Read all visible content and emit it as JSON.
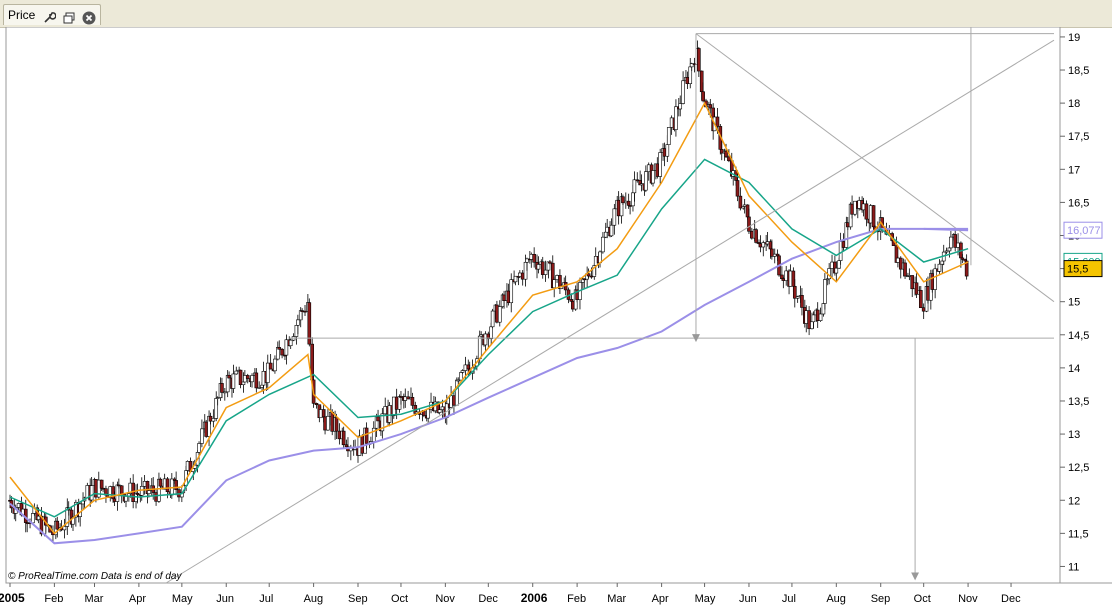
{
  "window": {
    "tab_title": "Price"
  },
  "icons": [
    "wrench-icon",
    "restore-window-icon",
    "close-icon"
  ],
  "colors": {
    "price_up": "#ffffff",
    "price_down": "#8b1a1a",
    "ma_short": "#f39c12",
    "ma_mid": "#17a589",
    "ma_long": "#9b8fe8",
    "trendlines": "#aaaaaa",
    "last_price_bg": "#f5c400"
  },
  "watermark": "© ProRealTime.com  Data is end of day",
  "chart_data": {
    "type": "line",
    "title": "Price",
    "ylim": [
      10.75,
      19.15
    ],
    "y_ticks": [
      "11",
      "11,5",
      "12",
      "12,5",
      "13",
      "13,5",
      "14",
      "14,5",
      "15",
      "15,5",
      "16",
      "16,5",
      "17",
      "17,5",
      "18",
      "18,5",
      "19"
    ],
    "x_labels": [
      "2005",
      "Feb",
      "Mar",
      "Apr",
      "May",
      "Jun",
      "Jul",
      "Aug",
      "Sep",
      "Oct",
      "Nov",
      "Dec",
      "2006",
      "Feb",
      "Mar",
      "Apr",
      "May",
      "Jun",
      "Jul",
      "Aug",
      "Sep",
      "Oct",
      "Nov",
      "Dec"
    ],
    "x_label_dates": [
      "2005-01",
      "2005-02",
      "2005-03",
      "2005-04",
      "2005-05",
      "2005-06",
      "2005-07",
      "2005-08",
      "2005-09",
      "2005-10",
      "2005-11",
      "2005-12",
      "2006-01",
      "2006-02",
      "2006-03",
      "2006-04",
      "2006-05",
      "2006-06",
      "2006-07",
      "2006-08",
      "2006-09",
      "2006-10",
      "2006-11",
      "2006-12"
    ],
    "series": [
      {
        "key": "price",
        "values": [
          [
            "2005-01",
            12.0
          ],
          [
            "2005-02",
            11.5
          ],
          [
            "2005-03",
            12.2
          ],
          [
            "2005-04",
            12.1
          ],
          [
            "2005-05",
            12.2
          ],
          [
            "2005-06",
            13.8
          ],
          [
            "2005-07",
            13.9
          ],
          [
            "2005-07-28",
            15.0
          ],
          [
            "2005-08",
            13.4
          ],
          [
            "2005-09",
            12.8
          ],
          [
            "2005-10",
            13.5
          ],
          [
            "2005-11",
            13.3
          ],
          [
            "2005-12",
            14.6
          ],
          [
            "2006-01",
            15.7
          ],
          [
            "2006-02",
            15.0
          ],
          [
            "2006-03",
            16.4
          ],
          [
            "2006-04",
            17.1
          ],
          [
            "2006-04-25",
            18.8
          ],
          [
            "2006-05",
            18.1
          ],
          [
            "2006-06",
            16.2
          ],
          [
            "2006-07",
            15.3
          ],
          [
            "2006-07-15",
            14.6
          ],
          [
            "2006-08",
            15.6
          ],
          [
            "2006-08-15",
            16.6
          ],
          [
            "2006-09",
            16.1
          ],
          [
            "2006-10",
            15.0
          ],
          [
            "2006-10-20",
            16.0
          ],
          [
            "2006-11",
            15.5
          ]
        ]
      },
      {
        "key": "ma_short",
        "values": [
          [
            "2005-01",
            12.35
          ],
          [
            "2005-02",
            11.5
          ],
          [
            "2005-03",
            12.0
          ],
          [
            "2005-04",
            12.15
          ],
          [
            "2005-05",
            12.2
          ],
          [
            "2005-06",
            13.4
          ],
          [
            "2005-07",
            13.7
          ],
          [
            "2005-07-28",
            14.2
          ],
          [
            "2005-08",
            13.6
          ],
          [
            "2005-09",
            12.95
          ],
          [
            "2005-10",
            13.2
          ],
          [
            "2005-11",
            13.5
          ],
          [
            "2005-12",
            14.3
          ],
          [
            "2006-01",
            15.1
          ],
          [
            "2006-02",
            15.3
          ],
          [
            "2006-03",
            15.8
          ],
          [
            "2006-04",
            16.8
          ],
          [
            "2006-05",
            18.0
          ],
          [
            "2006-06",
            16.6
          ],
          [
            "2006-07",
            15.9
          ],
          [
            "2006-08",
            15.3
          ],
          [
            "2006-09",
            16.2
          ],
          [
            "2006-10",
            15.3
          ],
          [
            "2006-11",
            15.6
          ]
        ]
      },
      {
        "key": "ma_mid",
        "values": [
          [
            "2005-01",
            12.05
          ],
          [
            "2005-02",
            11.75
          ],
          [
            "2005-03",
            12.1
          ],
          [
            "2005-04",
            12.05
          ],
          [
            "2005-05",
            12.1
          ],
          [
            "2005-06",
            13.2
          ],
          [
            "2005-07",
            13.6
          ],
          [
            "2005-08",
            13.9
          ],
          [
            "2005-09",
            13.25
          ],
          [
            "2005-10",
            13.3
          ],
          [
            "2005-11",
            13.5
          ],
          [
            "2005-12",
            14.2
          ],
          [
            "2006-01",
            14.85
          ],
          [
            "2006-02",
            15.15
          ],
          [
            "2006-03",
            15.4
          ],
          [
            "2006-04",
            16.4
          ],
          [
            "2006-05",
            17.15
          ],
          [
            "2006-06",
            16.8
          ],
          [
            "2006-07",
            16.1
          ],
          [
            "2006-08",
            15.7
          ],
          [
            "2006-09",
            16.1
          ],
          [
            "2006-10",
            15.6
          ],
          [
            "2006-11",
            15.8
          ]
        ]
      },
      {
        "key": "ma_long",
        "values": [
          [
            "2005-01",
            11.95
          ],
          [
            "2005-02",
            11.35
          ],
          [
            "2005-03",
            11.4
          ],
          [
            "2005-04",
            11.5
          ],
          [
            "2005-05",
            11.6
          ],
          [
            "2005-06",
            12.3
          ],
          [
            "2005-07",
            12.6
          ],
          [
            "2005-08",
            12.75
          ],
          [
            "2005-09",
            12.8
          ],
          [
            "2005-10",
            13.0
          ],
          [
            "2005-11",
            13.25
          ],
          [
            "2005-12",
            13.55
          ],
          [
            "2006-01",
            13.85
          ],
          [
            "2006-02",
            14.15
          ],
          [
            "2006-03",
            14.3
          ],
          [
            "2006-04",
            14.55
          ],
          [
            "2006-05",
            14.95
          ],
          [
            "2006-06",
            15.3
          ],
          [
            "2006-07",
            15.65
          ],
          [
            "2006-08",
            15.9
          ],
          [
            "2006-09",
            16.1
          ],
          [
            "2006-10",
            16.1
          ],
          [
            "2006-11",
            16.08
          ]
        ]
      }
    ],
    "reference_lines": [
      {
        "name": "resistance-line",
        "from": [
          "2006-04-25",
          19.05
        ],
        "to": [
          "2006-12-31",
          19.05
        ]
      },
      {
        "name": "support-line",
        "from": [
          "2005-07-15",
          14.45
        ],
        "to": [
          "2006-12-31",
          14.45
        ]
      },
      {
        "name": "rising-trendline",
        "from": [
          "2005-04-20",
          10.75
        ],
        "to": [
          "2006-12-31",
          18.95
        ]
      },
      {
        "name": "falling-trendline",
        "from": [
          "2006-04-25",
          19.05
        ],
        "to": [
          "2006-12-31",
          15.0
        ]
      },
      {
        "name": "target-down-arrow",
        "from": [
          "2006-09-25",
          14.45
        ],
        "to": [
          "2006-09-25",
          10.85
        ],
        "arrow": true
      },
      {
        "name": "target-up-arrow",
        "from": [
          "2006-11-03",
          15.55
        ],
        "to": [
          "2006-11-03",
          19.4
        ],
        "arrow": true
      },
      {
        "name": "pattern-height-arrow",
        "from": [
          "2006-04-25",
          19.05
        ],
        "to": [
          "2006-04-25",
          14.45
        ],
        "arrow": true
      },
      {
        "name": "level-line",
        "from": [
          "2006-10-01",
          16.1
        ],
        "to": [
          "2006-11-01",
          16.1
        ]
      }
    ],
    "value_labels": [
      {
        "key": "ma_long_value",
        "text": "16,077",
        "y": 16.08
      },
      {
        "key": "ma_mid_value",
        "text": "15,609",
        "y": 15.609
      },
      {
        "key": "last_price",
        "text": "15,5",
        "y": 15.5
      }
    ]
  }
}
